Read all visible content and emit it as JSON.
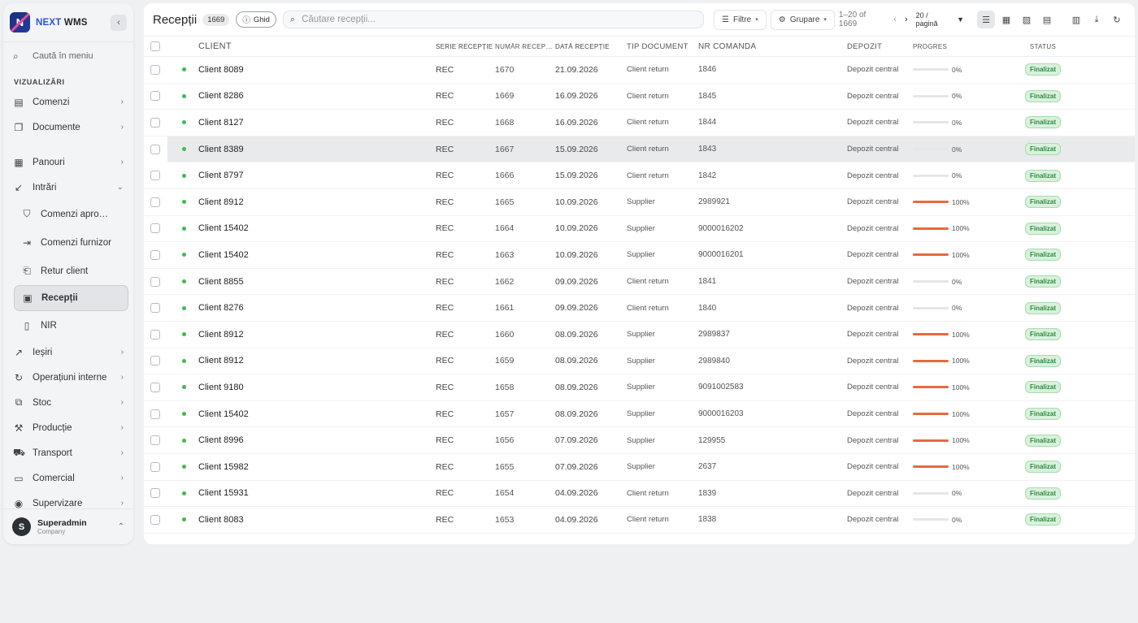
{
  "app": {
    "brand_part1": "NEXT",
    "brand_part2": "WMS",
    "logo_letter": "N",
    "accent": "#2a55d6"
  },
  "sidebar": {
    "search_placeholder": "Caută în meniu",
    "section_label": "VIZUALIZĂRI",
    "items": [
      {
        "label": "Comenzi",
        "icon": "list-icon"
      },
      {
        "label": "Documente",
        "icon": "documents-icon"
      },
      {
        "label": "Panouri",
        "icon": "grid-icon"
      },
      {
        "label": "Intrări",
        "icon": "arrow-down-left-icon"
      },
      {
        "label": "Comenzi aprovizionare",
        "icon": "basket-icon"
      },
      {
        "label": "Comenzi furnizor",
        "icon": "login-icon"
      },
      {
        "label": "Retur client",
        "icon": "return-icon"
      },
      {
        "label": "Recepții",
        "icon": "inbox-icon"
      },
      {
        "label": "NIR",
        "icon": "file-icon"
      },
      {
        "label": "Ieșiri",
        "icon": "arrow-up-right-icon"
      },
      {
        "label": "Operațiuni interne",
        "icon": "refresh-icon"
      },
      {
        "label": "Stoc",
        "icon": "box-icon"
      },
      {
        "label": "Producție",
        "icon": "hammer-icon"
      },
      {
        "label": "Transport",
        "icon": "truck-icon"
      },
      {
        "label": "Comercial",
        "icon": "money-icon"
      },
      {
        "label": "Supervizare",
        "icon": "eye-icon"
      }
    ],
    "user": {
      "initial": "S",
      "name": "Superadmin",
      "company": "Company"
    }
  },
  "toolbar": {
    "title": "Recepții",
    "count": "1669",
    "guide_label": "Ghid",
    "search_placeholder": "Căutare recepții...",
    "filters_label": "Filtre",
    "group_label": "Grupare",
    "range_label": "1–20 of 1669",
    "per_page_label": "20 / pagină"
  },
  "table": {
    "headers": {
      "client": "CLIENT",
      "serie": "SERIE RECEPȚIE",
      "numar": "NUMĂR RECEPȚIE",
      "data": "DATĂ RECEPȚIE",
      "tip": "TIP DOCUMENT",
      "nrcom": "NR COMANDĂ",
      "depozit": "DEPOZIT",
      "progres": "PROGRES",
      "status": "STATUS"
    },
    "rows": [
      {
        "client": "Client 8089",
        "serie": "REC",
        "numar": "1670",
        "data": "21.09.2026",
        "tip": "Client return",
        "nrcom": "1846",
        "depozit": "Depozit central",
        "progress": 0,
        "ptext": "0%",
        "status": "Finalizat"
      },
      {
        "client": "Client 8286",
        "serie": "REC",
        "numar": "1669",
        "data": "16.09.2026",
        "tip": "Client return",
        "nrcom": "1845",
        "depozit": "Depozit central",
        "progress": 0,
        "ptext": "0%",
        "status": "Finalizat"
      },
      {
        "client": "Client 8127",
        "serie": "REC",
        "numar": "1668",
        "data": "16.09.2026",
        "tip": "Client return",
        "nrcom": "1844",
        "depozit": "Depozit central",
        "progress": 0,
        "ptext": "0%",
        "status": "Finalizat"
      },
      {
        "client": "Client 8389",
        "serie": "REC",
        "numar": "1667",
        "data": "15.09.2026",
        "tip": "Client return",
        "nrcom": "1843",
        "depozit": "Depozit central",
        "progress": 0,
        "ptext": "0%",
        "status": "Finalizat"
      },
      {
        "client": "Client 8797",
        "serie": "REC",
        "numar": "1666",
        "data": "15.09.2026",
        "tip": "Client return",
        "nrcom": "1842",
        "depozit": "Depozit central",
        "progress": 0,
        "ptext": "0%",
        "status": "Finalizat"
      },
      {
        "client": "Client 8912",
        "serie": "REC",
        "numar": "1665",
        "data": "10.09.2026",
        "tip": "Supplier",
        "nrcom": "2989921",
        "depozit": "Depozit central",
        "progress": 100,
        "ptext": "100%",
        "status": "Finalizat"
      },
      {
        "client": "Client 15402",
        "serie": "REC",
        "numar": "1664",
        "data": "10.09.2026",
        "tip": "Supplier",
        "nrcom": "9000016202",
        "depozit": "Depozit central",
        "progress": 100,
        "ptext": "100%",
        "status": "Finalizat"
      },
      {
        "client": "Client 15402",
        "serie": "REC",
        "numar": "1663",
        "data": "10.09.2026",
        "tip": "Supplier",
        "nrcom": "9000016201",
        "depozit": "Depozit central",
        "progress": 100,
        "ptext": "100%",
        "status": "Finalizat"
      },
      {
        "client": "Client 8855",
        "serie": "REC",
        "numar": "1662",
        "data": "09.09.2026",
        "tip": "Client return",
        "nrcom": "1841",
        "depozit": "Depozit central",
        "progress": 0,
        "ptext": "0%",
        "status": "Finalizat"
      },
      {
        "client": "Client 8276",
        "serie": "REC",
        "numar": "1661",
        "data": "09.09.2026",
        "tip": "Client return",
        "nrcom": "1840",
        "depozit": "Depozit central",
        "progress": 0,
        "ptext": "0%",
        "status": "Finalizat"
      },
      {
        "client": "Client 8912",
        "serie": "REC",
        "numar": "1660",
        "data": "08.09.2026",
        "tip": "Supplier",
        "nrcom": "2989837",
        "depozit": "Depozit central",
        "progress": 100,
        "ptext": "100%",
        "status": "Finalizat"
      },
      {
        "client": "Client 8912",
        "serie": "REC",
        "numar": "1659",
        "data": "08.09.2026",
        "tip": "Supplier",
        "nrcom": "2989840",
        "depozit": "Depozit central",
        "progress": 100,
        "ptext": "100%",
        "status": "Finalizat"
      },
      {
        "client": "Client 9180",
        "serie": "REC",
        "numar": "1658",
        "data": "08.09.2026",
        "tip": "Supplier",
        "nrcom": "9091002583",
        "depozit": "Depozit central",
        "progress": 100,
        "ptext": "100%",
        "status": "Finalizat"
      },
      {
        "client": "Client 15402",
        "serie": "REC",
        "numar": "1657",
        "data": "08.09.2026",
        "tip": "Supplier",
        "nrcom": "9000016203",
        "depozit": "Depozit central",
        "progress": 100,
        "ptext": "100%",
        "status": "Finalizat"
      },
      {
        "client": "Client 8996",
        "serie": "REC",
        "numar": "1656",
        "data": "07.09.2026",
        "tip": "Supplier",
        "nrcom": "129955",
        "depozit": "Depozit central",
        "progress": 100,
        "ptext": "100%",
        "status": "Finalizat"
      },
      {
        "client": "Client 15982",
        "serie": "REC",
        "numar": "1655",
        "data": "07.09.2026",
        "tip": "Supplier",
        "nrcom": "2637",
        "depozit": "Depozit central",
        "progress": 100,
        "ptext": "100%",
        "status": "Finalizat"
      },
      {
        "client": "Client 15931",
        "serie": "REC",
        "numar": "1654",
        "data": "04.09.2026",
        "tip": "Client return",
        "nrcom": "1839",
        "depozit": "Depozit central",
        "progress": 0,
        "ptext": "0%",
        "status": "Finalizat"
      },
      {
        "client": "Client 8083",
        "serie": "REC",
        "numar": "1653",
        "data": "04.09.2026",
        "tip": "Client return",
        "nrcom": "1838",
        "depozit": "Depozit central",
        "progress": 0,
        "ptext": "0%",
        "status": "Finalizat"
      }
    ],
    "hover_row_index": 3,
    "colors": {
      "progress_fill": "#e86a3c",
      "status_green": "#2e8b3e",
      "dot_green": "#3fb950"
    }
  }
}
